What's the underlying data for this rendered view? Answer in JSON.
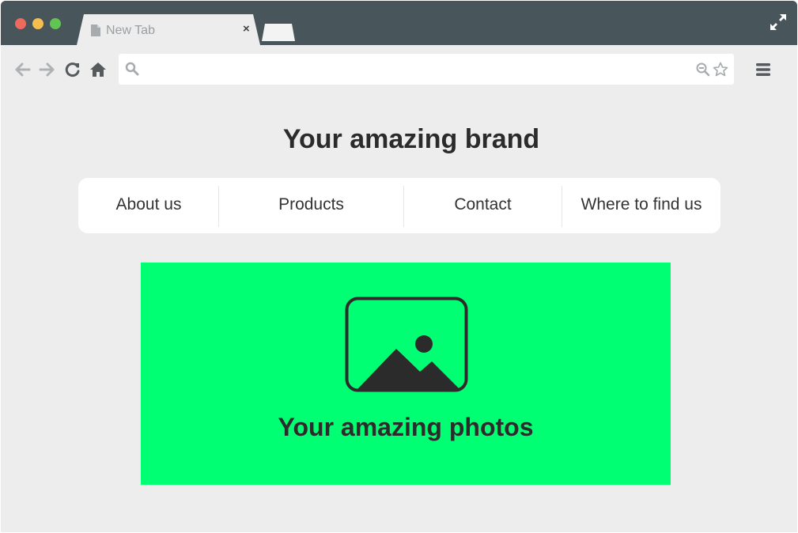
{
  "browser": {
    "tab_title": "New Tab",
    "tab_close_label": "×",
    "address_value": "",
    "address_placeholder": "",
    "colors": {
      "titlebar": "#48565b",
      "tab": "#ededed",
      "close_dot": "#ec6a5e",
      "minimize_dot": "#f4bf4f",
      "maximize_dot": "#61c554"
    },
    "icons": [
      "back-arrow-icon",
      "forward-arrow-icon",
      "reload-icon",
      "home-icon",
      "search-icon",
      "zoom-out-icon",
      "star-icon",
      "hamburger-menu-icon",
      "fullscreen-icon",
      "document-icon"
    ]
  },
  "page": {
    "brand_title": "Your amazing brand",
    "nav": [
      {
        "label": "About us"
      },
      {
        "label": "Products"
      },
      {
        "label": "Contact"
      },
      {
        "label": "Where to find us"
      }
    ],
    "hero": {
      "caption": "Your amazing photos",
      "background_color": "#00ff72",
      "icon": "image-placeholder-icon"
    }
  }
}
